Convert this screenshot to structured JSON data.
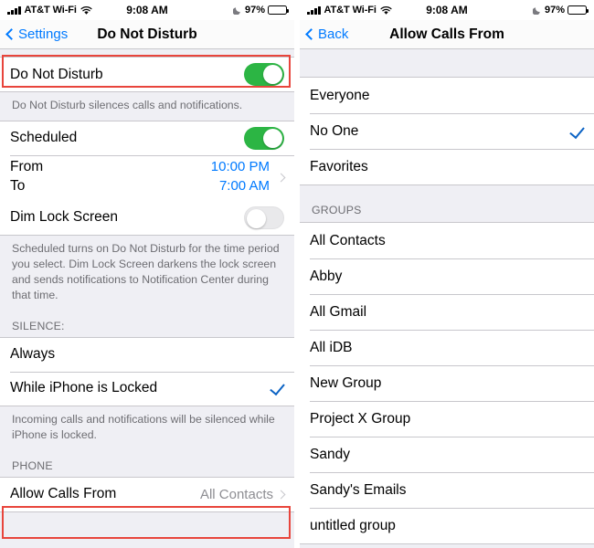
{
  "left": {
    "status_bar": {
      "carrier": "AT&T Wi-Fi",
      "time": "9:08 AM",
      "battery_percent": "97%",
      "signal_icon": "cellular-signal-icon",
      "wifi_icon": "wifi-icon",
      "dnd_icon": "moon-icon",
      "battery_icon": "battery-icon"
    },
    "nav": {
      "back_label": "Settings",
      "title": "Do Not Disturb"
    },
    "dnd_row": {
      "label": "Do Not Disturb",
      "toggle_state": "on"
    },
    "dnd_footer": "Do Not Disturb silences calls and notifications.",
    "scheduled_row": {
      "label": "Scheduled",
      "toggle_state": "on"
    },
    "from_row": {
      "label": "From",
      "value": "10:00 PM"
    },
    "to_row": {
      "label": "To",
      "value": "7:00 AM"
    },
    "dim_row": {
      "label": "Dim Lock Screen",
      "toggle_state": "off"
    },
    "scheduled_footer": "Scheduled turns on Do Not Disturb for the time period you select. Dim Lock Screen darkens the lock screen and sends notifications to Notification Center during that time.",
    "silence_header": "SILENCE:",
    "silence_options": [
      {
        "label": "Always",
        "selected": false
      },
      {
        "label": "While iPhone is Locked",
        "selected": true
      }
    ],
    "silence_footer": "Incoming calls and notifications will be silenced while iPhone is locked.",
    "phone_header": "PHONE",
    "allow_calls_row": {
      "label": "Allow Calls From",
      "value": "All Contacts"
    },
    "highlight_color": "#e8453c"
  },
  "right": {
    "status_bar": {
      "carrier": "AT&T Wi-Fi",
      "time": "9:08 AM",
      "battery_percent": "97%",
      "signal_icon": "cellular-signal-icon",
      "wifi_icon": "wifi-icon",
      "dnd_icon": "moon-icon",
      "battery_icon": "battery-icon"
    },
    "nav": {
      "back_label": "Back",
      "title": "Allow Calls From"
    },
    "primary_options": [
      {
        "label": "Everyone",
        "selected": false
      },
      {
        "label": "No One",
        "selected": true
      },
      {
        "label": "Favorites",
        "selected": false
      }
    ],
    "groups_header": "GROUPS",
    "groups": [
      {
        "label": "All Contacts",
        "selected": false
      },
      {
        "label": "Abby",
        "selected": false
      },
      {
        "label": "All Gmail",
        "selected": false
      },
      {
        "label": "All iDB",
        "selected": false
      },
      {
        "label": "New Group",
        "selected": false
      },
      {
        "label": "Project X Group",
        "selected": false
      },
      {
        "label": "Sandy",
        "selected": false
      },
      {
        "label": "Sandy's Emails",
        "selected": false
      },
      {
        "label": "untitled group",
        "selected": false
      }
    ]
  }
}
